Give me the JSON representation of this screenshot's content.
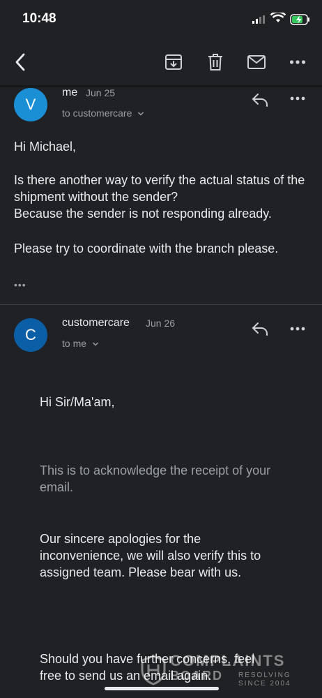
{
  "status_bar": {
    "time": "10:48"
  },
  "toolbar": {
    "back_icon": "chevron-left-icon",
    "archive_icon": "archive-icon",
    "delete_icon": "trash-icon",
    "mail_icon": "mail-icon",
    "more_icon": "more-horizontal-icon"
  },
  "messages": [
    {
      "avatar_letter": "V",
      "avatar_color": "#1a8fd6",
      "sender": "me",
      "date": "Jun 25",
      "to": "to customercare",
      "body": [
        "Hi Michael,",
        "Is there another way to verify the actual status of the shipment without the sender?",
        "Because the sender is not responding already.",
        "Please try to coordinate with the branch please."
      ],
      "ellipsis": "•••"
    },
    {
      "avatar_letter": "C",
      "avatar_color": "#0b5fa7",
      "sender": "customercare",
      "date": "Jun 26",
      "to": "to me",
      "body": [
        "Hi Sir/Ma'am,",
        "This is to acknowledge the receipt of your email.",
        "Our sincere apologies for the inconvenience, we will also verify this to assigned team. Please bear with us.",
        "Should you have further concerns, feel free to send us an email again."
      ]
    }
  ],
  "watermark": {
    "line1": "COMPLAINTS",
    "line2": "BOARD",
    "line3a": "RESOLVING",
    "line3b": "SINCE 2004"
  },
  "colors": {
    "background": "#202124",
    "text": "#e8eaed",
    "secondary_text": "#9aa0a6"
  }
}
